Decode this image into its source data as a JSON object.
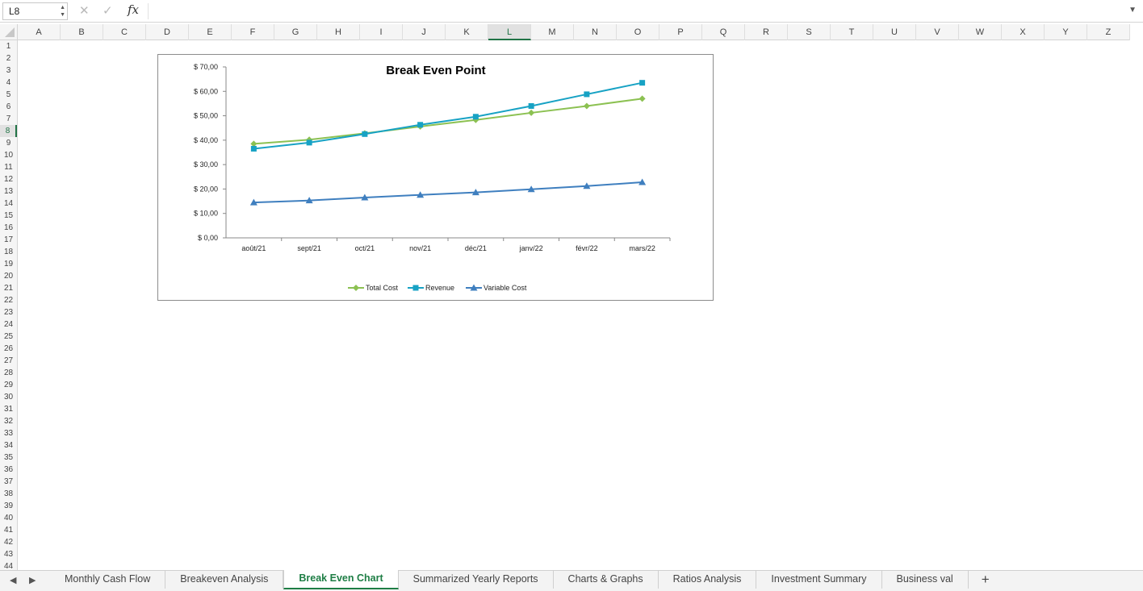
{
  "formula_bar": {
    "name_box": "L8",
    "cancel_icon": "✕",
    "enter_icon": "✓",
    "fx_label": "fx",
    "formula": ""
  },
  "columns": [
    "A",
    "B",
    "C",
    "D",
    "E",
    "F",
    "G",
    "H",
    "I",
    "J",
    "K",
    "L",
    "M",
    "N",
    "O",
    "P",
    "Q",
    "R",
    "S",
    "T",
    "U",
    "V",
    "W",
    "X",
    "Y",
    "Z"
  ],
  "selected_column": "L",
  "rows": [
    "1",
    "2",
    "3",
    "4",
    "5",
    "6",
    "7",
    "8",
    "9",
    "10",
    "11",
    "12",
    "13",
    "14",
    "15",
    "16",
    "17",
    "18",
    "19",
    "20",
    "21",
    "22",
    "23",
    "24",
    "25",
    "26",
    "27",
    "28",
    "29",
    "30",
    "31",
    "32",
    "33",
    "34",
    "35",
    "36",
    "37",
    "38",
    "39",
    "40",
    "41",
    "42",
    "43",
    "44"
  ],
  "selected_row": "8",
  "sheet_tabs": [
    "Monthly Cash Flow",
    "Breakeven Analysis",
    "Break Even Chart",
    "Summarized Yearly Reports",
    "Charts & Graphs",
    "Ratios Analysis",
    "Investment Summary",
    "Business val"
  ],
  "active_tab": "Break Even Chart",
  "add_sheet_label": "+",
  "chart_data": {
    "type": "line",
    "title": "Break Even Point",
    "categories": [
      "août/21",
      "sept/21",
      "oct/21",
      "nov/21",
      "déc/21",
      "janv/22",
      "févr/22",
      "mars/22"
    ],
    "y_ticks": [
      "$ 0,00",
      "$ 10,00",
      "$ 20,00",
      "$ 30,00",
      "$ 40,00",
      "$ 50,00",
      "$ 60,00",
      "$ 70,00"
    ],
    "ylim": [
      0,
      70
    ],
    "legend_position": "bottom",
    "series": [
      {
        "name": "Total Cost",
        "color": "#8cc152",
        "marker": "diamond",
        "values": [
          38.5,
          40.2,
          42.8,
          45.6,
          48.3,
          51.2,
          54.0,
          57.0
        ]
      },
      {
        "name": "Revenue",
        "color": "#17a2c4",
        "marker": "square",
        "values": [
          36.5,
          39.0,
          42.5,
          46.3,
          49.6,
          54.0,
          58.8,
          63.5
        ]
      },
      {
        "name": "Variable Cost",
        "color": "#3f7fbf",
        "marker": "triangle",
        "values": [
          14.5,
          15.3,
          16.5,
          17.6,
          18.6,
          19.9,
          21.2,
          22.8
        ]
      }
    ]
  }
}
